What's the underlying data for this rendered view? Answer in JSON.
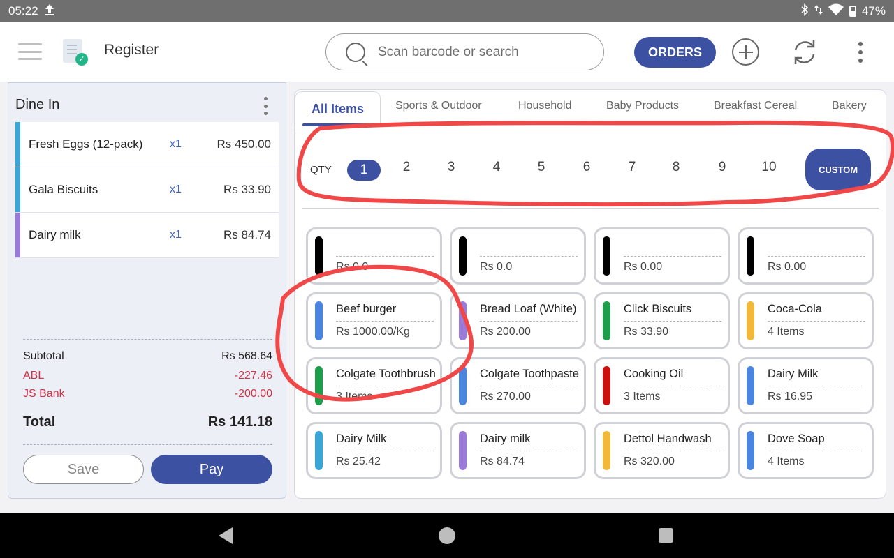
{
  "status_bar": {
    "time": "05:22",
    "battery": "47%"
  },
  "header": {
    "title": "Register",
    "search_placeholder": "Scan barcode or search",
    "orders_label": "ORDERS"
  },
  "cart": {
    "title": "Dine In",
    "items": [
      {
        "name": "Fresh Eggs (12-pack)",
        "qty": "x1",
        "price": "Rs 450.00",
        "color": "#3aa6d8"
      },
      {
        "name": "Gala Biscuits",
        "qty": "x1",
        "price": "Rs 33.90",
        "color": "#3aa6d8"
      },
      {
        "name": "Dairy milk",
        "qty": "x1",
        "price": "Rs 84.74",
        "color": "#9b7bd9"
      }
    ],
    "subtotal_label": "Subtotal",
    "subtotal_value": "Rs 568.64",
    "discounts": [
      {
        "label": "ABL",
        "value": "-227.46"
      },
      {
        "label": "JS Bank",
        "value": "-200.00"
      }
    ],
    "total_label": "Total",
    "total_value": "Rs 141.18",
    "save_label": "Save",
    "pay_label": "Pay"
  },
  "products": {
    "tabs": [
      "All Items",
      "Sports & Outdoor",
      "Household",
      "Baby Products",
      "Breakfast Cereal",
      "Bakery"
    ],
    "qty_label": "QTY",
    "qty_options": [
      "1",
      "2",
      "3",
      "4",
      "5",
      "6",
      "7",
      "8",
      "9",
      "10"
    ],
    "selected_qty": "1",
    "custom_label": "CUSTOM",
    "items": [
      {
        "name": "",
        "price": "Rs 0.0",
        "color": "#000000"
      },
      {
        "name": "",
        "price": "Rs 0.0",
        "color": "#000000"
      },
      {
        "name": "",
        "price": "Rs 0.00",
        "color": "#000000"
      },
      {
        "name": "",
        "price": "Rs 0.00",
        "color": "#000000"
      },
      {
        "name": "Beef burger",
        "price": "Rs 1000.00/Kg",
        "color": "#4a86e0"
      },
      {
        "name": "Bread Loaf (White)",
        "price": "Rs 200.00",
        "color": "#9b7bd9"
      },
      {
        "name": "Click Biscuits",
        "price": "Rs 33.90",
        "color": "#1e9e4a"
      },
      {
        "name": "Coca-Cola",
        "price": "4 Items",
        "color": "#f2b83a"
      },
      {
        "name": "Colgate Toothbrush",
        "price": "3 Items",
        "color": "#1e9e4a"
      },
      {
        "name": "Colgate Toothpaste",
        "price": "Rs 270.00",
        "color": "#4a86e0"
      },
      {
        "name": "Cooking Oil",
        "price": "3 Items",
        "color": "#cc1010"
      },
      {
        "name": "Dairy Milk",
        "price": "Rs 16.95",
        "color": "#4a86e0"
      },
      {
        "name": "Dairy Milk",
        "price": "Rs 25.42",
        "color": "#3aa6d8"
      },
      {
        "name": "Dairy milk",
        "price": "Rs 84.74",
        "color": "#9b7bd9"
      },
      {
        "name": "Dettol Handwash",
        "price": "Rs 320.00",
        "color": "#f2b83a"
      },
      {
        "name": "Dove Soap",
        "price": "4 Items",
        "color": "#4a86e0"
      }
    ]
  },
  "accent_color": "#3d51a3",
  "annotation_color": "#f04848"
}
